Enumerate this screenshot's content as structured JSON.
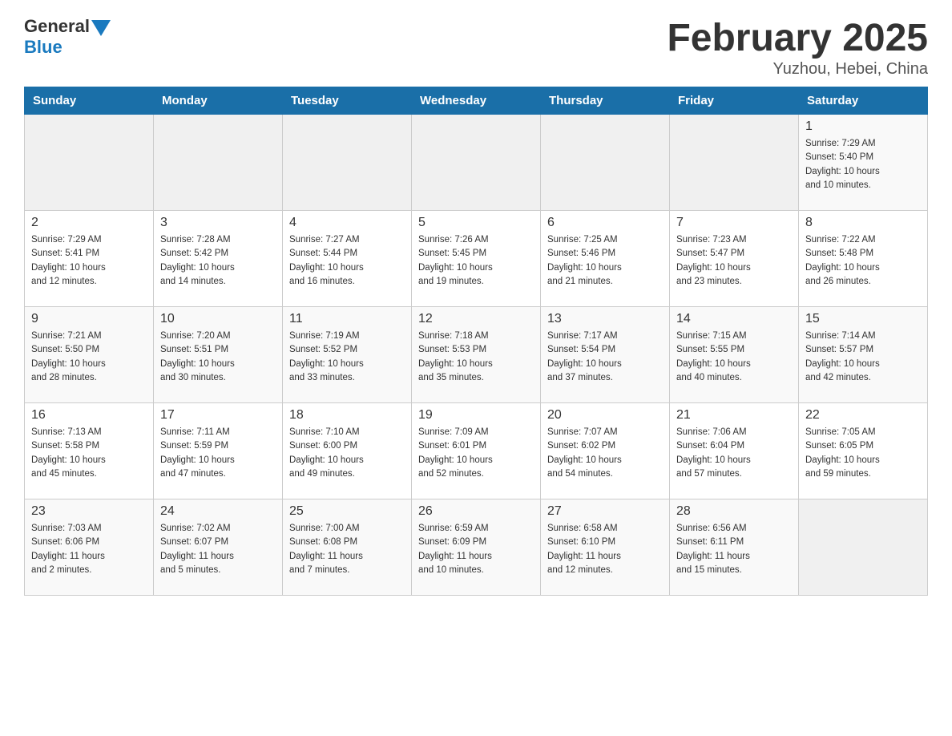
{
  "logo": {
    "general": "General",
    "blue": "Blue"
  },
  "title": "February 2025",
  "location": "Yuzhou, Hebei, China",
  "days_of_week": [
    "Sunday",
    "Monday",
    "Tuesday",
    "Wednesday",
    "Thursday",
    "Friday",
    "Saturday"
  ],
  "weeks": [
    [
      {
        "day": "",
        "info": ""
      },
      {
        "day": "",
        "info": ""
      },
      {
        "day": "",
        "info": ""
      },
      {
        "day": "",
        "info": ""
      },
      {
        "day": "",
        "info": ""
      },
      {
        "day": "",
        "info": ""
      },
      {
        "day": "1",
        "info": "Sunrise: 7:29 AM\nSunset: 5:40 PM\nDaylight: 10 hours\nand 10 minutes."
      }
    ],
    [
      {
        "day": "2",
        "info": "Sunrise: 7:29 AM\nSunset: 5:41 PM\nDaylight: 10 hours\nand 12 minutes."
      },
      {
        "day": "3",
        "info": "Sunrise: 7:28 AM\nSunset: 5:42 PM\nDaylight: 10 hours\nand 14 minutes."
      },
      {
        "day": "4",
        "info": "Sunrise: 7:27 AM\nSunset: 5:44 PM\nDaylight: 10 hours\nand 16 minutes."
      },
      {
        "day": "5",
        "info": "Sunrise: 7:26 AM\nSunset: 5:45 PM\nDaylight: 10 hours\nand 19 minutes."
      },
      {
        "day": "6",
        "info": "Sunrise: 7:25 AM\nSunset: 5:46 PM\nDaylight: 10 hours\nand 21 minutes."
      },
      {
        "day": "7",
        "info": "Sunrise: 7:23 AM\nSunset: 5:47 PM\nDaylight: 10 hours\nand 23 minutes."
      },
      {
        "day": "8",
        "info": "Sunrise: 7:22 AM\nSunset: 5:48 PM\nDaylight: 10 hours\nand 26 minutes."
      }
    ],
    [
      {
        "day": "9",
        "info": "Sunrise: 7:21 AM\nSunset: 5:50 PM\nDaylight: 10 hours\nand 28 minutes."
      },
      {
        "day": "10",
        "info": "Sunrise: 7:20 AM\nSunset: 5:51 PM\nDaylight: 10 hours\nand 30 minutes."
      },
      {
        "day": "11",
        "info": "Sunrise: 7:19 AM\nSunset: 5:52 PM\nDaylight: 10 hours\nand 33 minutes."
      },
      {
        "day": "12",
        "info": "Sunrise: 7:18 AM\nSunset: 5:53 PM\nDaylight: 10 hours\nand 35 minutes."
      },
      {
        "day": "13",
        "info": "Sunrise: 7:17 AM\nSunset: 5:54 PM\nDaylight: 10 hours\nand 37 minutes."
      },
      {
        "day": "14",
        "info": "Sunrise: 7:15 AM\nSunset: 5:55 PM\nDaylight: 10 hours\nand 40 minutes."
      },
      {
        "day": "15",
        "info": "Sunrise: 7:14 AM\nSunset: 5:57 PM\nDaylight: 10 hours\nand 42 minutes."
      }
    ],
    [
      {
        "day": "16",
        "info": "Sunrise: 7:13 AM\nSunset: 5:58 PM\nDaylight: 10 hours\nand 45 minutes."
      },
      {
        "day": "17",
        "info": "Sunrise: 7:11 AM\nSunset: 5:59 PM\nDaylight: 10 hours\nand 47 minutes."
      },
      {
        "day": "18",
        "info": "Sunrise: 7:10 AM\nSunset: 6:00 PM\nDaylight: 10 hours\nand 49 minutes."
      },
      {
        "day": "19",
        "info": "Sunrise: 7:09 AM\nSunset: 6:01 PM\nDaylight: 10 hours\nand 52 minutes."
      },
      {
        "day": "20",
        "info": "Sunrise: 7:07 AM\nSunset: 6:02 PM\nDaylight: 10 hours\nand 54 minutes."
      },
      {
        "day": "21",
        "info": "Sunrise: 7:06 AM\nSunset: 6:04 PM\nDaylight: 10 hours\nand 57 minutes."
      },
      {
        "day": "22",
        "info": "Sunrise: 7:05 AM\nSunset: 6:05 PM\nDaylight: 10 hours\nand 59 minutes."
      }
    ],
    [
      {
        "day": "23",
        "info": "Sunrise: 7:03 AM\nSunset: 6:06 PM\nDaylight: 11 hours\nand 2 minutes."
      },
      {
        "day": "24",
        "info": "Sunrise: 7:02 AM\nSunset: 6:07 PM\nDaylight: 11 hours\nand 5 minutes."
      },
      {
        "day": "25",
        "info": "Sunrise: 7:00 AM\nSunset: 6:08 PM\nDaylight: 11 hours\nand 7 minutes."
      },
      {
        "day": "26",
        "info": "Sunrise: 6:59 AM\nSunset: 6:09 PM\nDaylight: 11 hours\nand 10 minutes."
      },
      {
        "day": "27",
        "info": "Sunrise: 6:58 AM\nSunset: 6:10 PM\nDaylight: 11 hours\nand 12 minutes."
      },
      {
        "day": "28",
        "info": "Sunrise: 6:56 AM\nSunset: 6:11 PM\nDaylight: 11 hours\nand 15 minutes."
      },
      {
        "day": "",
        "info": ""
      }
    ]
  ]
}
